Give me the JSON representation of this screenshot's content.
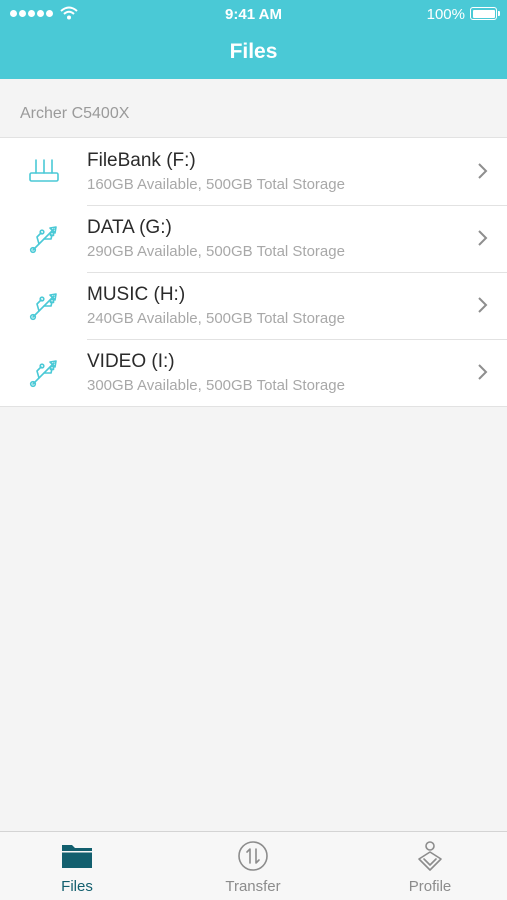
{
  "status_bar": {
    "time": "9:41 AM",
    "battery": "100%"
  },
  "header": {
    "title": "Files"
  },
  "device": {
    "name": "Archer C5400X"
  },
  "drives": [
    {
      "name": "FileBank (F:)",
      "storage": "160GB Available, 500GB Total Storage",
      "icon": "router-icon"
    },
    {
      "name": "DATA (G:)",
      "storage": "290GB Available, 500GB Total Storage",
      "icon": "usb-icon"
    },
    {
      "name": "MUSIC (H:)",
      "storage": "240GB Available, 500GB Total Storage",
      "icon": "usb-icon"
    },
    {
      "name": "VIDEO (I:)",
      "storage": "300GB Available, 500GB Total Storage",
      "icon": "usb-icon"
    }
  ],
  "tabs": [
    {
      "label": "Files",
      "icon": "folder-icon",
      "active": true
    },
    {
      "label": "Transfer",
      "icon": "transfer-icon",
      "active": false
    },
    {
      "label": "Profile",
      "icon": "profile-icon",
      "active": false
    }
  ],
  "colors": {
    "accent": "#4ac9d6",
    "active_tab": "#125f6e",
    "inactive_tab": "#8c8c8c"
  }
}
